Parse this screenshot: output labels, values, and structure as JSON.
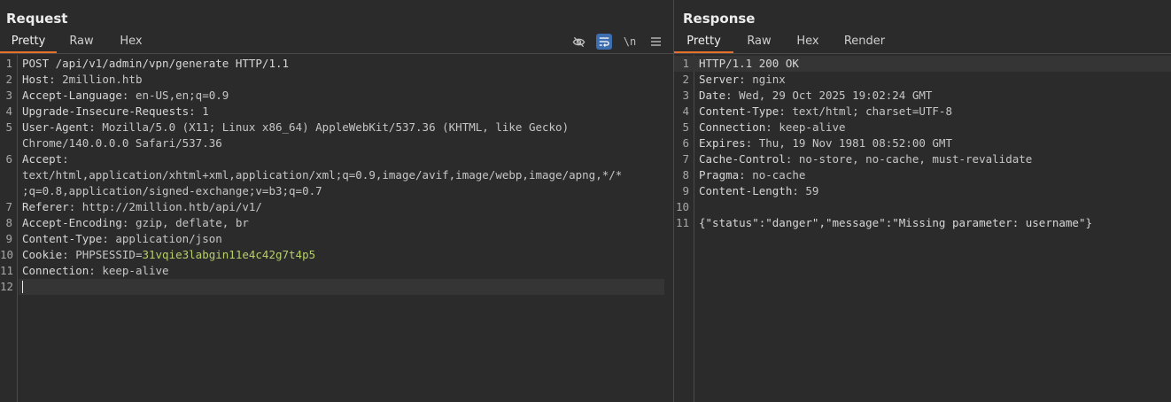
{
  "request": {
    "title": "Request",
    "tabs": [
      "Pretty",
      "Raw",
      "Hex"
    ],
    "active_tab": "Pretty",
    "toolbar": {
      "hide_icon": "eye-slash-icon",
      "wrap_icon": "word-wrap-icon",
      "newline_label": "\\n",
      "menu_icon": "hamburger-menu-icon"
    },
    "lines": [
      {
        "n": "1",
        "key": "POST /api/v1/admin/vpn/generate HTTP/1.1",
        "val": ""
      },
      {
        "n": "2",
        "key": "Host",
        "val": ": 2million.htb"
      },
      {
        "n": "3",
        "key": "Accept-Language",
        "val": ": en-US,en;q=0.9"
      },
      {
        "n": "4",
        "key": "Upgrade-Insecure-Requests",
        "val": ": 1"
      },
      {
        "n": "5",
        "key": "User-Agent",
        "val": ": Mozilla/5.0 (X11; Linux x86_64) AppleWebKit/537.36 (KHTML, like Gecko)"
      },
      {
        "n": "",
        "key": "",
        "val": "Chrome/140.0.0.0 Safari/537.36"
      },
      {
        "n": "6",
        "key": "Accept",
        "val": ":"
      },
      {
        "n": "",
        "key": "",
        "val": "text/html,application/xhtml+xml,application/xml;q=0.9,image/avif,image/webp,image/apng,*/*"
      },
      {
        "n": "",
        "key": "",
        "val": ";q=0.8,application/signed-exchange;v=b3;q=0.7"
      },
      {
        "n": "7",
        "key": "Referer",
        "val": ": http://2million.htb/api/v1/"
      },
      {
        "n": "8",
        "key": "Accept-Encoding",
        "val": ": gzip, deflate, br"
      },
      {
        "n": "9",
        "key": "Content-Type",
        "val": ": application/json"
      },
      {
        "n": "10",
        "key": "Cookie",
        "val": ": PHPSESSID=",
        "cookie_val": "31vqie3labgin11e4c42g7t4p5"
      },
      {
        "n": "11",
        "key": "Connection",
        "val": ": keep-alive"
      },
      {
        "n": "12",
        "key": "",
        "val": ""
      }
    ]
  },
  "response": {
    "title": "Response",
    "tabs": [
      "Pretty",
      "Raw",
      "Hex",
      "Render"
    ],
    "active_tab": "Pretty",
    "lines": [
      {
        "n": "1",
        "key": "HTTP/1.1 200 OK",
        "val": ""
      },
      {
        "n": "2",
        "key": "Server",
        "val": ": nginx"
      },
      {
        "n": "3",
        "key": "Date",
        "val": ": Wed, 29 Oct 2025 19:02:24 GMT"
      },
      {
        "n": "4",
        "key": "Content-Type",
        "val": ": text/html; charset=UTF-8"
      },
      {
        "n": "5",
        "key": "Connection",
        "val": ": keep-alive"
      },
      {
        "n": "6",
        "key": "Expires",
        "val": ": Thu, 19 Nov 1981 08:52:00 GMT"
      },
      {
        "n": "7",
        "key": "Cache-Control",
        "val": ": no-store, no-cache, must-revalidate"
      },
      {
        "n": "8",
        "key": "Pragma",
        "val": ": no-cache"
      },
      {
        "n": "9",
        "key": "Content-Length",
        "val": ": 59"
      },
      {
        "n": "10",
        "key": "",
        "val": ""
      },
      {
        "n": "11",
        "key": "{\"status\":\"danger\",\"message\":\"Missing parameter: username\"}",
        "val": ""
      }
    ]
  },
  "colors": {
    "background": "#2b2b2b",
    "accent": "#e8702a",
    "cookie_value": "#b5cf6b",
    "toggle_on": "#3d6fb0"
  }
}
